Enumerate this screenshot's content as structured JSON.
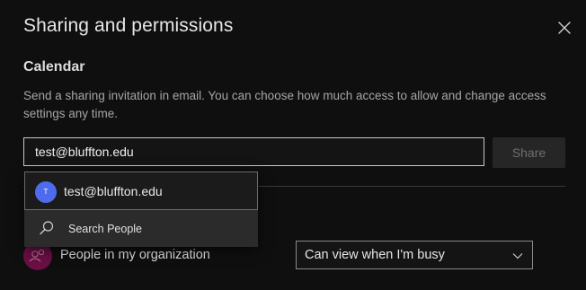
{
  "dialog": {
    "title": "Sharing and permissions",
    "close_icon": "close-icon"
  },
  "calendar": {
    "heading": "Calendar",
    "description": "Send a sharing invitation in email. You can choose how much access to allow and change access settings any time."
  },
  "invite": {
    "input_value": "test@bluffton.edu",
    "share_label": "Share"
  },
  "suggestions": {
    "items": [
      {
        "initial": "T",
        "email": "test@bluffton.edu",
        "avatar_color": "#4f6bed"
      }
    ],
    "search_label": "Search People",
    "search_icon": "search-icon"
  },
  "permissions": {
    "rows": [
      {
        "label": "People in my organization",
        "value": "Can view when I'm busy",
        "avatar_icon": "people-icon",
        "avatar_color": "#6b0f44"
      }
    ]
  },
  "colors": {
    "background": "#0f0f0f",
    "input_border": "#c8c8c8",
    "share_button_bg": "#262626"
  }
}
